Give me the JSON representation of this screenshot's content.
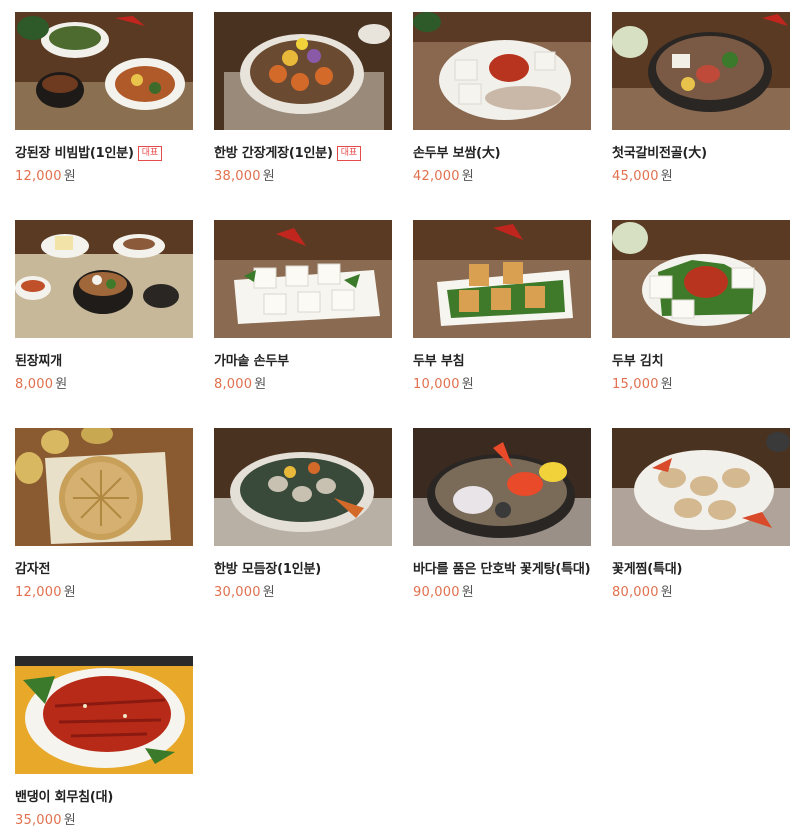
{
  "products": [
    {
      "name": "강된장 비빔밥(1인분)",
      "badge": "대표",
      "price": "12,000",
      "unit": "원",
      "icon": "bibimbap-photo"
    },
    {
      "name": "한방 간장게장(1인분)",
      "badge": "대표",
      "price": "38,000",
      "unit": "원",
      "icon": "crab-platter-photo"
    },
    {
      "name": "손두부 보쌈(大)",
      "badge": "",
      "price": "42,000",
      "unit": "원",
      "icon": "bossam-photo"
    },
    {
      "name": "첫국갈비전골(大)",
      "badge": "",
      "price": "45,000",
      "unit": "원",
      "icon": "hotpot-photo"
    },
    {
      "name": "된장찌개",
      "badge": "",
      "price": "8,000",
      "unit": "원",
      "icon": "doenjang-stew-photo"
    },
    {
      "name": "가마솥 손두부",
      "badge": "",
      "price": "8,000",
      "unit": "원",
      "icon": "tofu-photo"
    },
    {
      "name": "두부 부침",
      "badge": "",
      "price": "10,000",
      "unit": "원",
      "icon": "fried-tofu-photo"
    },
    {
      "name": "두부 김치",
      "badge": "",
      "price": "15,000",
      "unit": "원",
      "icon": "tofu-kimchi-photo"
    },
    {
      "name": "감자전",
      "badge": "",
      "price": "12,000",
      "unit": "원",
      "icon": "potato-pancake-photo"
    },
    {
      "name": "한방 모듬장(1인분)",
      "badge": "",
      "price": "30,000",
      "unit": "원",
      "icon": "seafood-platter-photo"
    },
    {
      "name": "바다를 품은 단호박 꽃게탕(특대)",
      "badge": "",
      "price": "90,000",
      "unit": "원",
      "icon": "crab-stew-photo"
    },
    {
      "name": "꽃게찜(특대)",
      "badge": "",
      "price": "80,000",
      "unit": "원",
      "icon": "steamed-crab-photo"
    },
    {
      "name": "밴댕이 회무침(대)",
      "badge": "",
      "price": "35,000",
      "unit": "원",
      "icon": "raw-fish-salad-photo"
    }
  ]
}
